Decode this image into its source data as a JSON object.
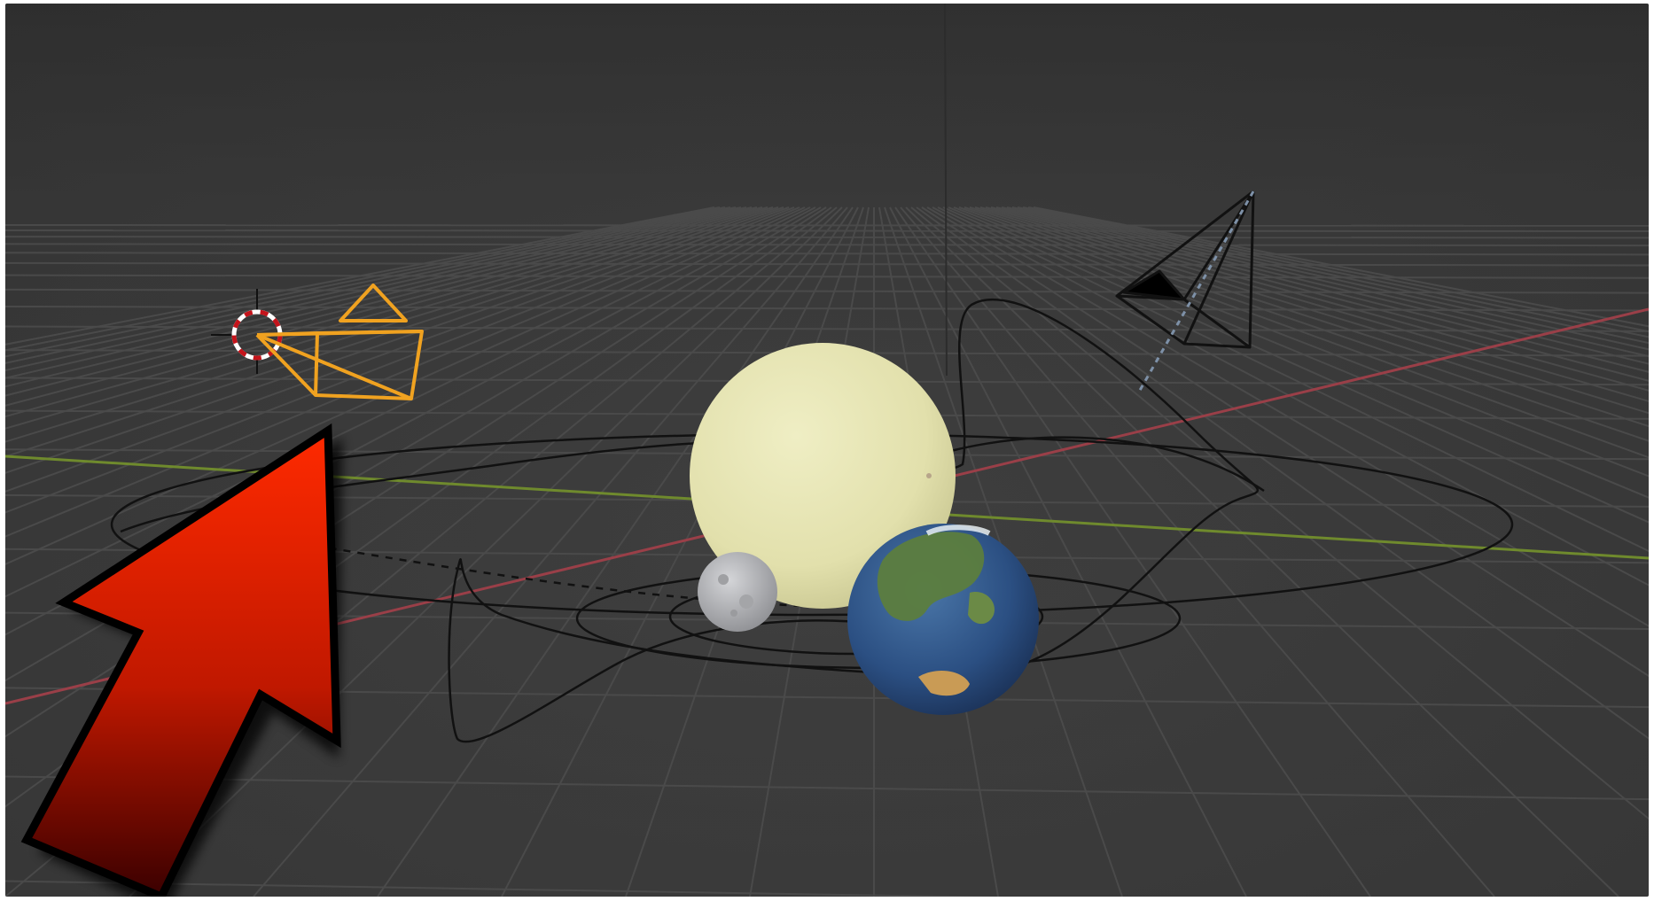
{
  "app": {
    "name": "3D viewport"
  },
  "colors": {
    "viewport_bg": "#3b3b3b",
    "grid": "#4a4a4a",
    "x_axis": "#9a3f48",
    "y_axis": "#6f8a2d",
    "selection_orange": "#f0a220",
    "sun": "#e6e4b2",
    "earth_ocean": "#2a4d7d",
    "earth_land": "#5a7a3c",
    "moon": "#b7b8bb",
    "motion_path": "#111111",
    "arrow_top": "#ff2a00",
    "arrow_bottom": "#3a0000"
  },
  "objects": [
    {
      "name": "3d-cursor",
      "icon": "crosshair-icon"
    },
    {
      "name": "selected-camera",
      "icon": "camera-icon"
    },
    {
      "name": "scene-camera",
      "icon": "camera-icon"
    },
    {
      "name": "sun-sphere",
      "icon": "sphere-icon"
    },
    {
      "name": "earth-sphere",
      "icon": "sphere-icon"
    },
    {
      "name": "moon-sphere",
      "icon": "sphere-icon"
    }
  ],
  "annotation": {
    "icon": "arrow-up-right-icon"
  }
}
